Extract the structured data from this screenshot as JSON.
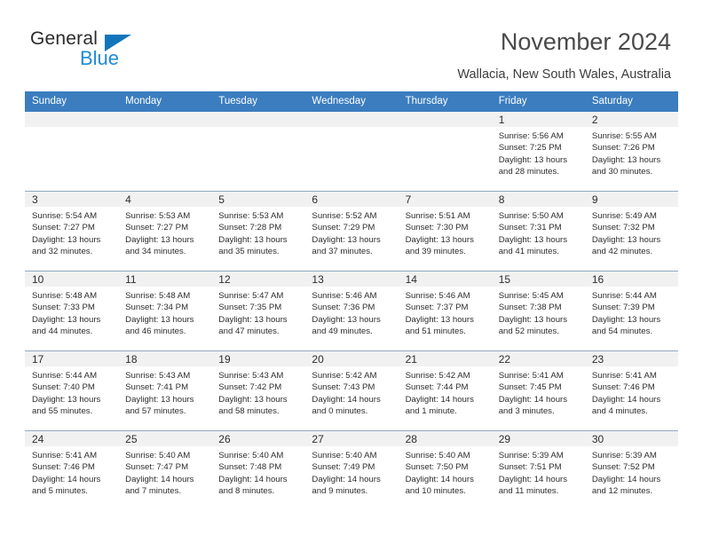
{
  "logo": {
    "text_top": "General",
    "text_bottom": "Blue",
    "triangle_color": "#1175bc",
    "blue_color": "#1e8ad6"
  },
  "header": {
    "title": "November 2024",
    "subtitle": "Wallacia, New South Wales, Australia"
  },
  "theme": {
    "header_bar_color": "#3b7dbf",
    "day_head_color": "#f1f1f1",
    "grid_line_color": "#8fa9c4"
  },
  "weekdays": [
    "Sunday",
    "Monday",
    "Tuesday",
    "Wednesday",
    "Thursday",
    "Friday",
    "Saturday"
  ],
  "weeks": [
    [
      {
        "empty": true
      },
      {
        "empty": true
      },
      {
        "empty": true
      },
      {
        "empty": true
      },
      {
        "empty": true
      },
      {
        "day": "1",
        "sunrise": "Sunrise: 5:56 AM",
        "sunset": "Sunset: 7:25 PM",
        "daylight": "Daylight: 13 hours and 28 minutes."
      },
      {
        "day": "2",
        "sunrise": "Sunrise: 5:55 AM",
        "sunset": "Sunset: 7:26 PM",
        "daylight": "Daylight: 13 hours and 30 minutes."
      }
    ],
    [
      {
        "day": "3",
        "sunrise": "Sunrise: 5:54 AM",
        "sunset": "Sunset: 7:27 PM",
        "daylight": "Daylight: 13 hours and 32 minutes."
      },
      {
        "day": "4",
        "sunrise": "Sunrise: 5:53 AM",
        "sunset": "Sunset: 7:27 PM",
        "daylight": "Daylight: 13 hours and 34 minutes."
      },
      {
        "day": "5",
        "sunrise": "Sunrise: 5:53 AM",
        "sunset": "Sunset: 7:28 PM",
        "daylight": "Daylight: 13 hours and 35 minutes."
      },
      {
        "day": "6",
        "sunrise": "Sunrise: 5:52 AM",
        "sunset": "Sunset: 7:29 PM",
        "daylight": "Daylight: 13 hours and 37 minutes."
      },
      {
        "day": "7",
        "sunrise": "Sunrise: 5:51 AM",
        "sunset": "Sunset: 7:30 PM",
        "daylight": "Daylight: 13 hours and 39 minutes."
      },
      {
        "day": "8",
        "sunrise": "Sunrise: 5:50 AM",
        "sunset": "Sunset: 7:31 PM",
        "daylight": "Daylight: 13 hours and 41 minutes."
      },
      {
        "day": "9",
        "sunrise": "Sunrise: 5:49 AM",
        "sunset": "Sunset: 7:32 PM",
        "daylight": "Daylight: 13 hours and 42 minutes."
      }
    ],
    [
      {
        "day": "10",
        "sunrise": "Sunrise: 5:48 AM",
        "sunset": "Sunset: 7:33 PM",
        "daylight": "Daylight: 13 hours and 44 minutes."
      },
      {
        "day": "11",
        "sunrise": "Sunrise: 5:48 AM",
        "sunset": "Sunset: 7:34 PM",
        "daylight": "Daylight: 13 hours and 46 minutes."
      },
      {
        "day": "12",
        "sunrise": "Sunrise: 5:47 AM",
        "sunset": "Sunset: 7:35 PM",
        "daylight": "Daylight: 13 hours and 47 minutes."
      },
      {
        "day": "13",
        "sunrise": "Sunrise: 5:46 AM",
        "sunset": "Sunset: 7:36 PM",
        "daylight": "Daylight: 13 hours and 49 minutes."
      },
      {
        "day": "14",
        "sunrise": "Sunrise: 5:46 AM",
        "sunset": "Sunset: 7:37 PM",
        "daylight": "Daylight: 13 hours and 51 minutes."
      },
      {
        "day": "15",
        "sunrise": "Sunrise: 5:45 AM",
        "sunset": "Sunset: 7:38 PM",
        "daylight": "Daylight: 13 hours and 52 minutes."
      },
      {
        "day": "16",
        "sunrise": "Sunrise: 5:44 AM",
        "sunset": "Sunset: 7:39 PM",
        "daylight": "Daylight: 13 hours and 54 minutes."
      }
    ],
    [
      {
        "day": "17",
        "sunrise": "Sunrise: 5:44 AM",
        "sunset": "Sunset: 7:40 PM",
        "daylight": "Daylight: 13 hours and 55 minutes."
      },
      {
        "day": "18",
        "sunrise": "Sunrise: 5:43 AM",
        "sunset": "Sunset: 7:41 PM",
        "daylight": "Daylight: 13 hours and 57 minutes."
      },
      {
        "day": "19",
        "sunrise": "Sunrise: 5:43 AM",
        "sunset": "Sunset: 7:42 PM",
        "daylight": "Daylight: 13 hours and 58 minutes."
      },
      {
        "day": "20",
        "sunrise": "Sunrise: 5:42 AM",
        "sunset": "Sunset: 7:43 PM",
        "daylight": "Daylight: 14 hours and 0 minutes."
      },
      {
        "day": "21",
        "sunrise": "Sunrise: 5:42 AM",
        "sunset": "Sunset: 7:44 PM",
        "daylight": "Daylight: 14 hours and 1 minute."
      },
      {
        "day": "22",
        "sunrise": "Sunrise: 5:41 AM",
        "sunset": "Sunset: 7:45 PM",
        "daylight": "Daylight: 14 hours and 3 minutes."
      },
      {
        "day": "23",
        "sunrise": "Sunrise: 5:41 AM",
        "sunset": "Sunset: 7:46 PM",
        "daylight": "Daylight: 14 hours and 4 minutes."
      }
    ],
    [
      {
        "day": "24",
        "sunrise": "Sunrise: 5:41 AM",
        "sunset": "Sunset: 7:46 PM",
        "daylight": "Daylight: 14 hours and 5 minutes."
      },
      {
        "day": "25",
        "sunrise": "Sunrise: 5:40 AM",
        "sunset": "Sunset: 7:47 PM",
        "daylight": "Daylight: 14 hours and 7 minutes."
      },
      {
        "day": "26",
        "sunrise": "Sunrise: 5:40 AM",
        "sunset": "Sunset: 7:48 PM",
        "daylight": "Daylight: 14 hours and 8 minutes."
      },
      {
        "day": "27",
        "sunrise": "Sunrise: 5:40 AM",
        "sunset": "Sunset: 7:49 PM",
        "daylight": "Daylight: 14 hours and 9 minutes."
      },
      {
        "day": "28",
        "sunrise": "Sunrise: 5:40 AM",
        "sunset": "Sunset: 7:50 PM",
        "daylight": "Daylight: 14 hours and 10 minutes."
      },
      {
        "day": "29",
        "sunrise": "Sunrise: 5:39 AM",
        "sunset": "Sunset: 7:51 PM",
        "daylight": "Daylight: 14 hours and 11 minutes."
      },
      {
        "day": "30",
        "sunrise": "Sunrise: 5:39 AM",
        "sunset": "Sunset: 7:52 PM",
        "daylight": "Daylight: 14 hours and 12 minutes."
      }
    ]
  ]
}
